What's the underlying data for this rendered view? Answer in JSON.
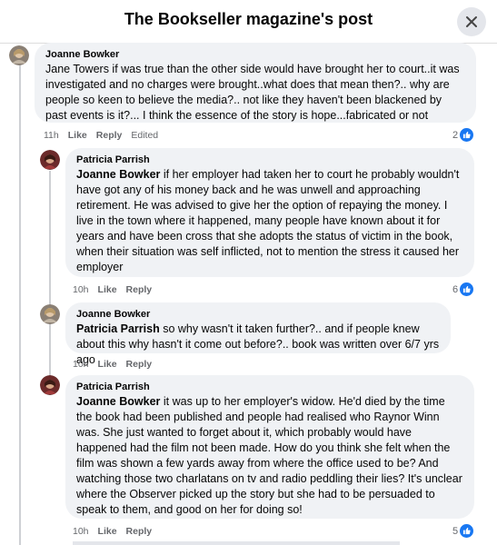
{
  "header": {
    "title": "The Bookseller magazine's post"
  },
  "comments": [
    {
      "author": "Joanne Bowker",
      "mention": "",
      "text": "Jane Towers if was true than the other side would have brought her to court..it was investigated and no charges were brought..what does that mean then?.. why are people so keen to believe the media?.. not like they haven't been blackened by past events is it?... I think the essence of the story is hope...fabricated or not",
      "time": "11h",
      "like": "Like",
      "reply": "Reply",
      "edited": "Edited",
      "reactions": "2"
    },
    {
      "author": "Patricia Parrish",
      "mention": "Joanne Bowker",
      "text": " if her employer had taken her to court he probably wouldn't have got any of his money back and he was unwell and approaching retirement. He was advised to give her the option of repaying the money. I live in the town where it happened, many people have known about it for years and have been cross that she adopts the status of victim in the book, when their situation was self inflicted, not to mention the stress it caused her employer",
      "time": "10h",
      "like": "Like",
      "reply": "Reply",
      "reactions": "6"
    },
    {
      "author": "Joanne Bowker",
      "mention": "Patricia Parrish",
      "text": " so why wasn't it taken further?.. and if people knew about this why hasn't it come out before?.. book was written over 6/7 yrs ago",
      "time": "10h",
      "like": "Like",
      "reply": "Reply"
    },
    {
      "author": "Patricia Parrish",
      "mention": "Joanne Bowker",
      "text": " it was up to her employer's widow. He'd died by the time the book had been published and people had realised who Raynor Winn was. She just wanted to forget about it, which probably would have happened had the film not been made. How do you think she felt when the film was shown a few yards away from where the office used to be? And watching those two charlatans on tv and radio peddling their lies? It's unclear where the Observer picked up the story but she had to be persuaded to speak to them, and good on her for doing so!",
      "time": "10h",
      "like": "Like",
      "reply": "Reply",
      "reactions": "5"
    }
  ]
}
